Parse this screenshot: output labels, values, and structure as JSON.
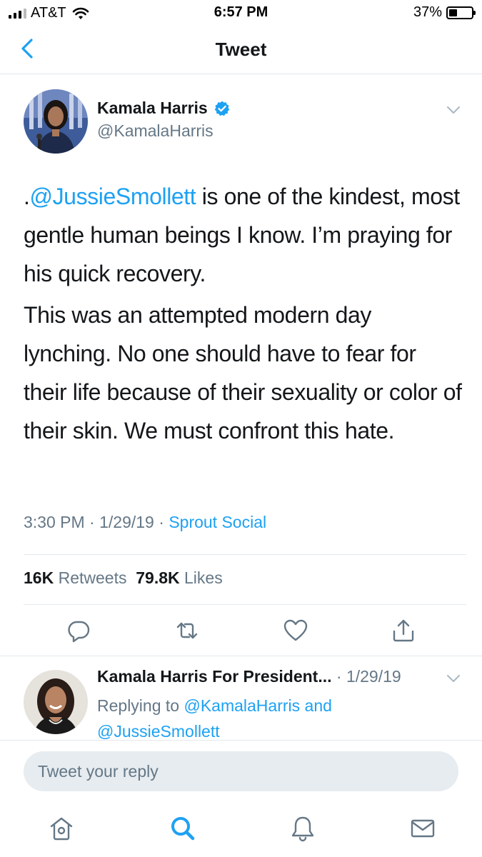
{
  "status_bar": {
    "carrier": "AT&T",
    "time": "6:57 PM",
    "battery": "37%",
    "battery_level": 0.37
  },
  "nav": {
    "title": "Tweet"
  },
  "tweet": {
    "author_name": "Kamala Harris",
    "author_handle": "@KamalaHarris",
    "paragraph1_prefix": ".",
    "paragraph1_mention": "@JussieSmollett",
    "paragraph1_rest": " is one of the kindest, most gentle human beings I know. I’m praying for his quick recovery.",
    "paragraph2": "This was an attempted modern day lynching. No one should have to fear for their life because of their sexuality or color of their skin. We must confront this hate.",
    "time": "3:30 PM",
    "date": "1/29/19",
    "separator": " · ",
    "source": "Sprout Social",
    "retweets_count": "16K",
    "retweets_label": "Retweets",
    "likes_count": "79.8K",
    "likes_label": "Likes"
  },
  "reply": {
    "author_name": "Kamala Harris For President...",
    "date": " · 1/29/19",
    "replying_prefix": "Replying to ",
    "mention1": "@KamalaHarris",
    "and": " and",
    "mention2": "@JussieSmollett"
  },
  "reply_box": {
    "placeholder": "Tweet your reply"
  },
  "icons": {
    "back": "chevron-left-icon",
    "verified": "verified-badge-icon",
    "caret": "chevron-down-icon",
    "reply": "reply-icon",
    "retweet": "retweet-icon",
    "like": "heart-icon",
    "share": "share-icon",
    "home": "home-icon",
    "search": "search-icon",
    "notifications": "bell-icon",
    "messages": "mail-icon"
  },
  "colors": {
    "accent": "#1da1f2",
    "text": "#14171a",
    "secondary": "#657786",
    "divider": "#e1e8ed"
  }
}
